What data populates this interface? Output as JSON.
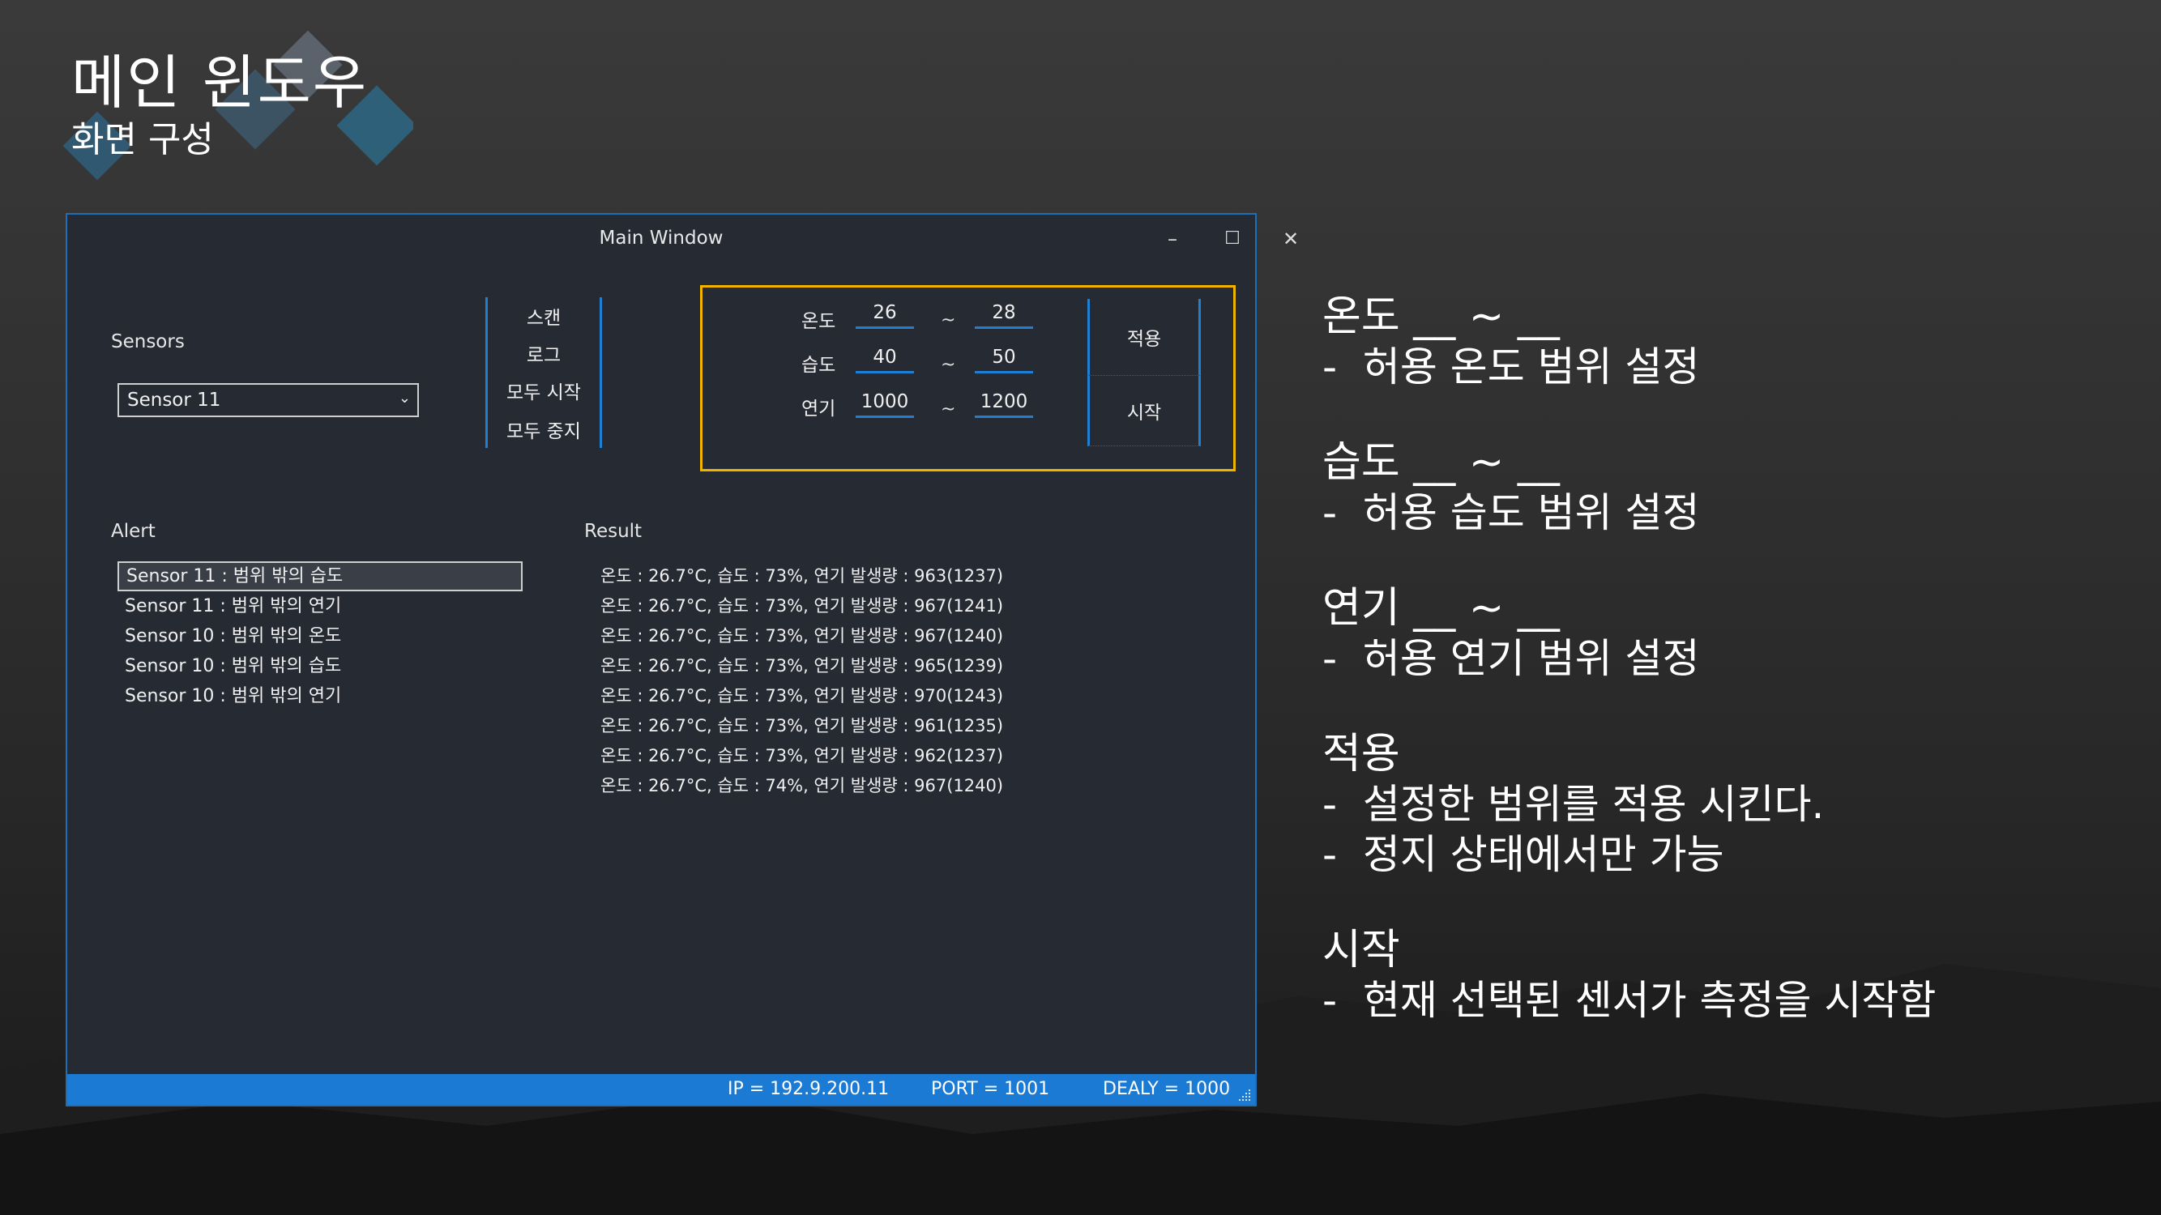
{
  "slide": {
    "title": "메인 윈도우",
    "subtitle": "화면 구성"
  },
  "window": {
    "title": "Main Window",
    "controls": {
      "minimize": "–",
      "maximize": "☐",
      "close": "✕"
    },
    "sensors_label": "Sensors",
    "sensor_selected": "Sensor 11",
    "menu": [
      "스캔",
      "로그",
      "모두 시작",
      "모두 중지"
    ],
    "ranges": {
      "temp": {
        "label": "온도",
        "min": "26",
        "max": "28"
      },
      "humidity": {
        "label": "습도",
        "min": "40",
        "max": "50"
      },
      "smoke": {
        "label": "연기",
        "min": "1000",
        "max": "1200"
      },
      "tilde": "~"
    },
    "apply_button": "적용",
    "start_button": "시작",
    "alert_label": "Alert",
    "result_label": "Result",
    "alerts": [
      "Sensor 11 : 범위 밖의 습도",
      "Sensor 11 : 범위 밖의 연기",
      "Sensor 10 : 범위 밖의 온도",
      "Sensor 10 : 범위 밖의 습도",
      "Sensor 10 : 범위 밖의 연기"
    ],
    "results": [
      "온도 : 26.7°C, 습도 : 73%, 연기 발생량 : 963(1237)",
      "온도 : 26.7°C, 습도 : 73%, 연기 발생량 : 967(1241)",
      "온도 : 26.7°C, 습도 : 73%, 연기 발생량 : 967(1240)",
      "온도 : 26.7°C, 습도 : 73%, 연기 발생량 : 965(1239)",
      "온도 : 26.7°C, 습도 : 73%, 연기 발생량 : 970(1243)",
      "온도 : 26.7°C, 습도 : 73%, 연기 발생량 : 961(1235)",
      "온도 : 26.7°C, 습도 : 73%, 연기 발생량 : 962(1237)",
      "온도 : 26.7°C, 습도 : 74%, 연기 발생량 : 967(1240)"
    ],
    "status": {
      "ip": "IP = 192.9.200.11",
      "port": "PORT = 1001",
      "delay": "DEALY = 1000"
    }
  },
  "notes": [
    {
      "head": "온도 __ ~ __",
      "lines": [
        "-  허용 온도 범위 설정"
      ]
    },
    {
      "head": "습도 __ ~ __",
      "lines": [
        "-  허용 습도 범위 설정"
      ]
    },
    {
      "head": "연기 __ ~ __",
      "lines": [
        "-  허용 연기 범위 설정"
      ]
    },
    {
      "head": "적용",
      "lines": [
        "-  설정한 범위를 적용 시킨다.",
        "-  정지 상태에서만 가능"
      ]
    },
    {
      "head": "시작",
      "lines": [
        "-  현재 선택된 센서가 측정을 시작함"
      ]
    }
  ],
  "colors": {
    "accent_blue": "#1f7fd4",
    "highlight_yellow": "#f0b400",
    "window_bg": "#262a33"
  }
}
